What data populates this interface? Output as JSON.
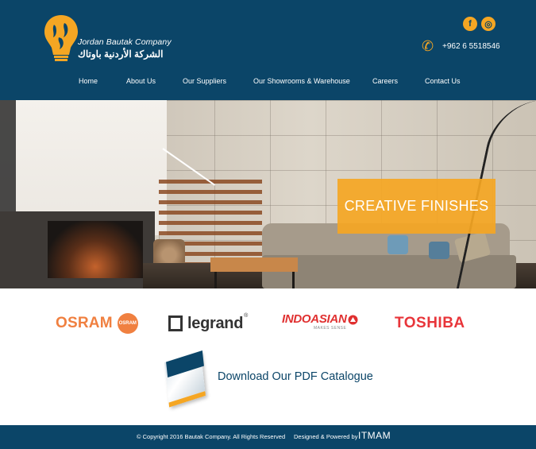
{
  "header": {
    "logo_en": "Jordan Bautak Company",
    "logo_ar": "الشركة الأردنية باوتاك",
    "phone": "+962 6 5518546",
    "social": [
      {
        "name": "facebook",
        "glyph": "f"
      },
      {
        "name": "instagram",
        "glyph": "◎"
      }
    ],
    "nav": [
      "Home",
      "About Us",
      "Our Suppliers",
      "Our Showrooms & Warehouse",
      "Careers",
      "Contact Us"
    ]
  },
  "hero": {
    "banner": "CREATIVE FINISHES"
  },
  "brands": {
    "osram": "OSRAM",
    "osram_badge": "OSRAM",
    "legrand": "legrand",
    "legrand_reg": "®",
    "indoasian": "INDOASIAN",
    "indoasian_tagline": "MAKES SENSE",
    "toshiba": "TOSHIBA"
  },
  "catalogue": {
    "link": "Download Our PDF Catalogue"
  },
  "footer": {
    "copyright": "© Copyright 2016 Bautak Company. All Rights Reserved",
    "designed": "Designed & Powered by",
    "powered_brand": "ITMAM"
  },
  "colors": {
    "navy": "#0b4568",
    "accent": "#f5a623"
  }
}
